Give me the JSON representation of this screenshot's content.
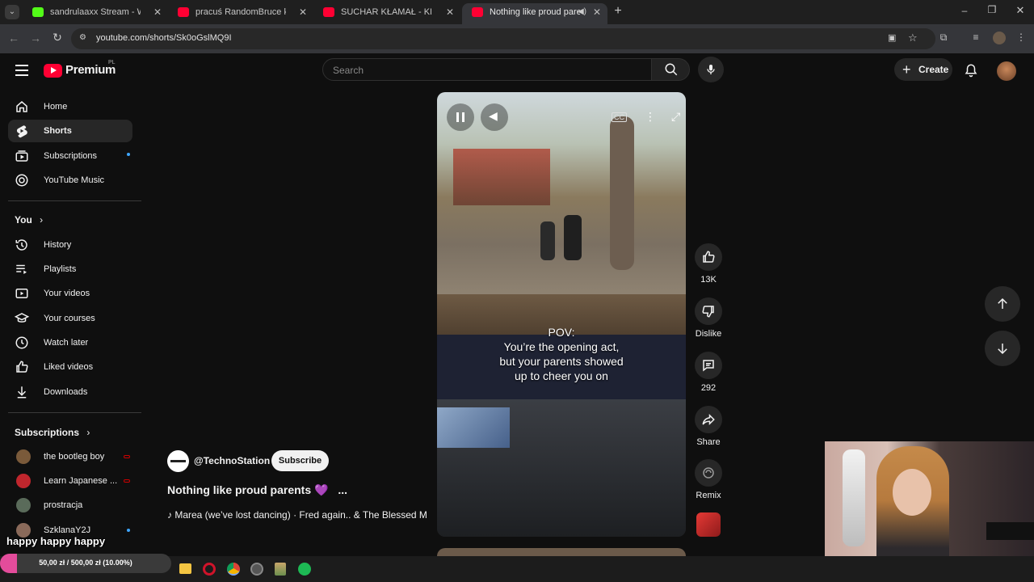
{
  "browser": {
    "tabs": [
      {
        "title": "sandrulaaxx Stream - Watch Live o",
        "favicon_color": "#53fc18"
      },
      {
        "title": "pracuś RandomBruce kończy strea",
        "favicon_color": "#ff0033"
      },
      {
        "title": "SUCHAR KŁAMAŁ - KICK PŁACI ZA",
        "favicon_color": "#ff0033"
      },
      {
        "title": "Nothing like proud parents",
        "favicon_color": "#ff0033"
      }
    ],
    "url": "youtube.com/shorts/Sk0oGslMQ9I"
  },
  "youtube": {
    "logo_text": "Premium",
    "logo_badge": "PL",
    "search_placeholder": "Search",
    "create_label": "Create",
    "sidebar": {
      "main": [
        {
          "label": "Home",
          "icon": "home-icon"
        },
        {
          "label": "Shorts",
          "icon": "shorts-icon",
          "active": true
        },
        {
          "label": "Subscriptions",
          "icon": "subscriptions-icon"
        },
        {
          "label": "YouTube Music",
          "icon": "music-icon"
        }
      ],
      "you_title": "You",
      "you": [
        {
          "label": "History",
          "icon": "history-icon"
        },
        {
          "label": "Playlists",
          "icon": "playlists-icon"
        },
        {
          "label": "Your videos",
          "icon": "your-videos-icon"
        },
        {
          "label": "Your courses",
          "icon": "courses-icon"
        },
        {
          "label": "Watch later",
          "icon": "watch-later-icon"
        },
        {
          "label": "Liked videos",
          "icon": "like-icon"
        },
        {
          "label": "Downloads",
          "icon": "download-icon"
        }
      ],
      "subs_title": "Subscriptions",
      "subscriptions": [
        {
          "label": "the bootleg boy",
          "status": "live",
          "avatar_color": "#7a5a3a"
        },
        {
          "label": "Learn Japanese ...",
          "status": "live",
          "avatar_color": "#c0262d"
        },
        {
          "label": "prostracja",
          "status": "",
          "avatar_color": "#5a6b5a"
        },
        {
          "label": "SzklanaY2J",
          "status": "new",
          "avatar_color": "#8a6a5a"
        }
      ]
    },
    "short": {
      "caption_line1": "POV:",
      "caption_line2": "You’re the opening act,",
      "caption_line3": "but your parents showed",
      "caption_line4": "up to cheer you on",
      "channel": "@TechnoStation",
      "subscribe_label": "Subscribe",
      "title": "Nothing like proud parents 💜",
      "more": "...",
      "music": "♪ Marea (we’ve lost dancing) · Fred again.. & The Blessed M"
    },
    "actions": {
      "likes": "13K",
      "dislike": "Dislike",
      "comments": "292",
      "share": "Share",
      "remix": "Remix"
    }
  },
  "overlay": {
    "chat_text": "happy happy happy",
    "goal_text": "50,00 zł / 500,00 zł (10.00%)",
    "goal_progress": 0.1
  }
}
